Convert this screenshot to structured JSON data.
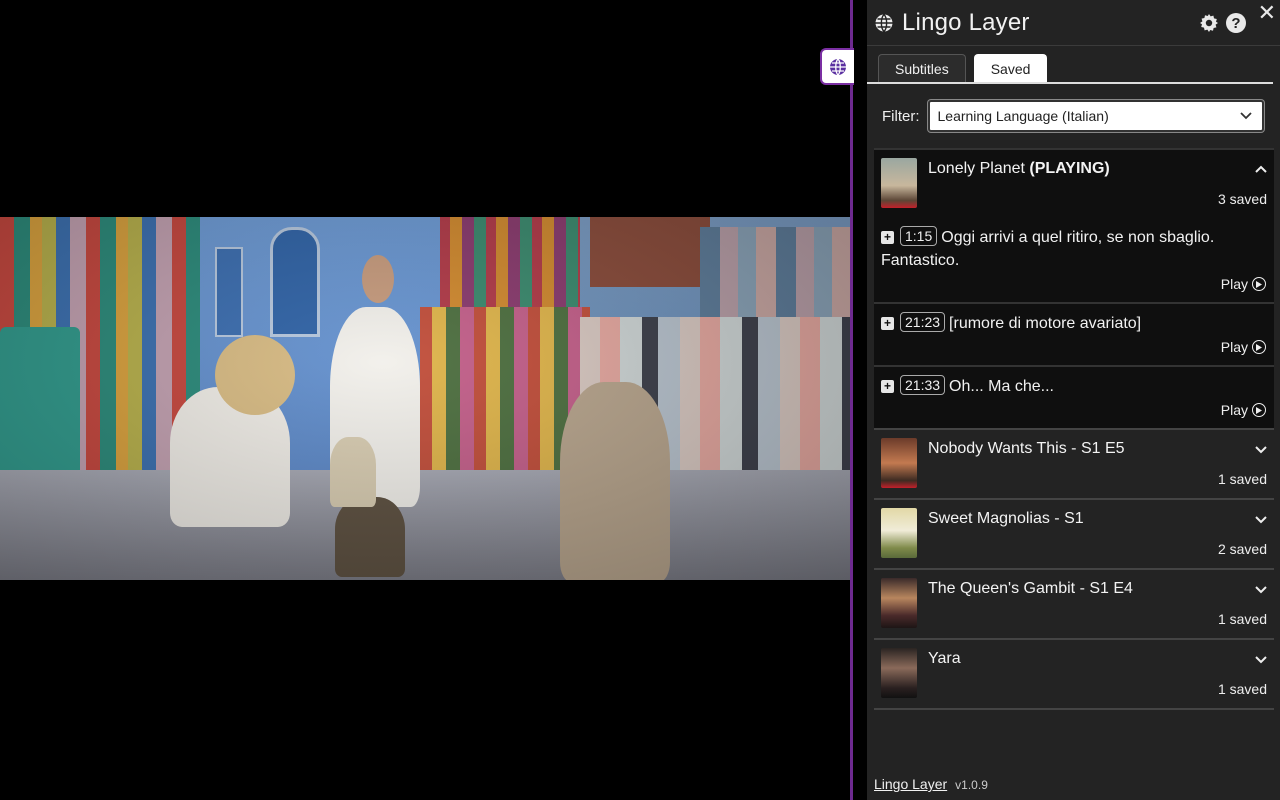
{
  "panel": {
    "title": "Lingo Layer",
    "tabs": [
      {
        "label": "Subtitles",
        "active": false
      },
      {
        "label": "Saved",
        "active": true
      }
    ],
    "filter": {
      "label": "Filter:",
      "selected": "Learning Language (Italian)"
    },
    "groups": [
      {
        "title": "Lonely Planet",
        "status": "(PLAYING)",
        "count": "3 saved",
        "expanded": true,
        "entries": [
          {
            "time": "1:15",
            "text": "Oggi arrivi a quel ritiro, se non sbaglio. Fantastico.",
            "play": "Play"
          },
          {
            "time": "21:23",
            "text": "[rumore di motore avariato]",
            "play": "Play"
          },
          {
            "time": "21:33",
            "text": "Oh... Ma che...",
            "play": "Play"
          }
        ]
      },
      {
        "title": "Nobody Wants This - S1 E5",
        "count": "1 saved",
        "expanded": false
      },
      {
        "title": "Sweet Magnolias - S1",
        "count": "2 saved",
        "expanded": false
      },
      {
        "title": "The Queen's Gambit - S1 E4",
        "count": "1 saved",
        "expanded": false
      },
      {
        "title": "Yara",
        "count": "1 saved",
        "expanded": false
      }
    ],
    "footer": {
      "link": "Lingo Layer",
      "version": "v1.0.9"
    }
  },
  "colors": {
    "panel_bg": "#232323",
    "expanded_bg": "#0f0f0f",
    "accent_purple": "#6d2a8f"
  }
}
